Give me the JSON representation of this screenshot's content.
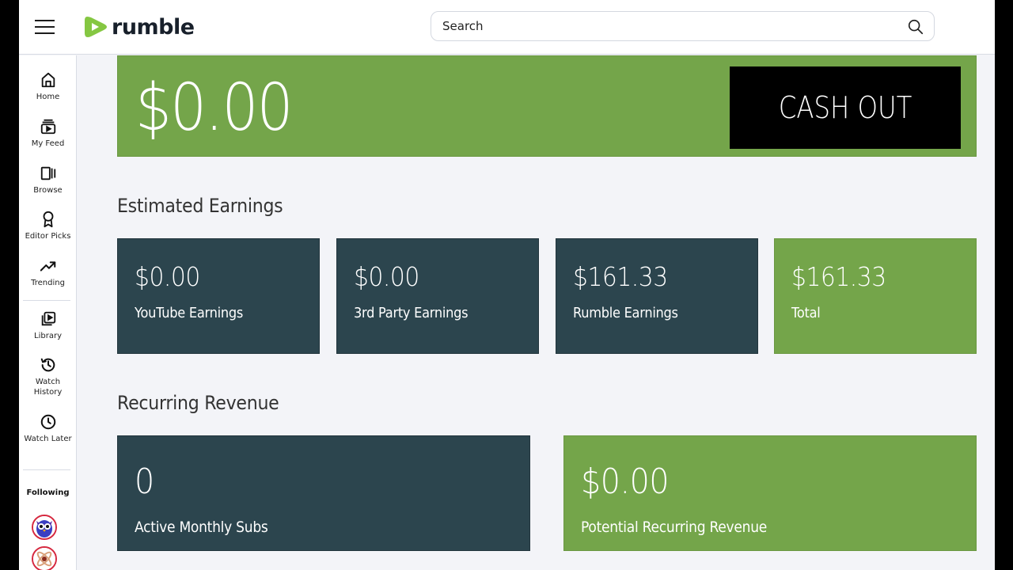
{
  "header": {
    "logo_text": "rumble",
    "search_placeholder": "Search"
  },
  "sidebar": {
    "items": [
      {
        "label": "Home",
        "icon": "home-icon"
      },
      {
        "label": "My Feed",
        "icon": "feed-icon"
      },
      {
        "label": "Browse",
        "icon": "browse-icon"
      },
      {
        "label": "Editor Picks",
        "icon": "award-icon"
      },
      {
        "label": "Trending",
        "icon": "trending-icon"
      },
      {
        "label": "Library",
        "icon": "library-icon"
      },
      {
        "label": "Watch History",
        "icon": "history-icon"
      },
      {
        "label": "Watch Later",
        "icon": "clock-icon"
      }
    ],
    "following_label": "Following",
    "following_avatars": [
      "owl-avatar",
      "channel-avatar"
    ]
  },
  "balance": {
    "amount": "$0.00",
    "cashout_label": "CASH OUT"
  },
  "estimated_earnings": {
    "title": "Estimated Earnings",
    "cards": [
      {
        "value": "$0.00",
        "label": "YouTube Earnings",
        "style": "dark"
      },
      {
        "value": "$0.00",
        "label": "3rd Party Earnings",
        "style": "dark"
      },
      {
        "value": "$161.33",
        "label": "Rumble Earnings",
        "style": "dark"
      },
      {
        "value": "$161.33",
        "label": "Total",
        "style": "green"
      }
    ]
  },
  "recurring_revenue": {
    "title": "Recurring Revenue",
    "cards": [
      {
        "value": "0",
        "label": "Active Monthly Subs",
        "style": "dark"
      },
      {
        "value": "$0.00",
        "label": "Potential Recurring Revenue",
        "style": "green"
      }
    ]
  },
  "colors": {
    "brand_green": "#74a54a",
    "dark_card": "#2c454e",
    "logo_green": "#85c742",
    "page_bg": "#f3f4f8"
  }
}
